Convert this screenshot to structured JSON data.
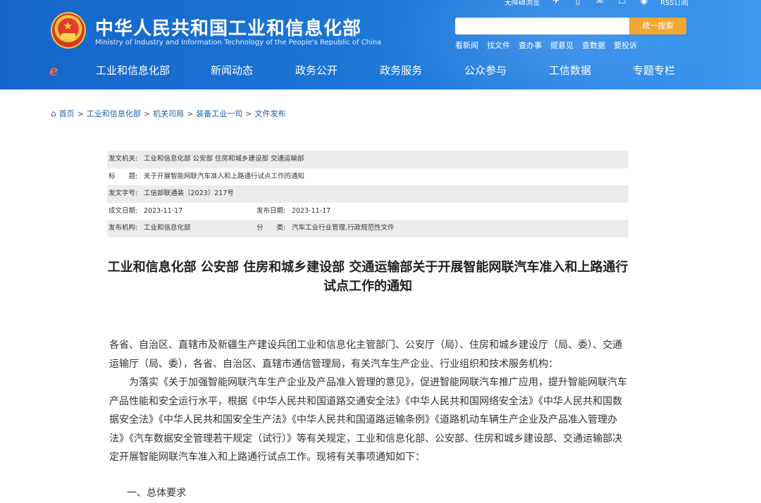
{
  "header": {
    "ministry_name_cn": "中华人民共和国工业和信息化部",
    "ministry_name_en": "Ministry of Industry and Information Technology of the People's Republic of China",
    "accessibility_label": "无障碍浏览",
    "rss_label": "RSS订阅",
    "search": {
      "placeholder": "",
      "button_label": "统一搜索"
    },
    "quick_links": [
      "看新闻",
      "找文件",
      "查办事",
      "提意见",
      "查数据",
      "要投诉"
    ],
    "nav": [
      "工业和信息化部",
      "新闻动态",
      "政务公开",
      "政务服务",
      "公众参与",
      "工信数据",
      "专题专栏"
    ]
  },
  "breadcrumb": [
    "首页",
    "工业和信息化部",
    "机关司局",
    "装备工业一司",
    "文件发布"
  ],
  "meta": {
    "issuer_label": "发文机关:",
    "issuer_value": "工业和信息化部 公安部 住房和城乡建设部 交通运输部",
    "title_label": "标　　题:",
    "title_value": "关于开展智能网联汽车准入和上路通行试点工作的通知",
    "docno_label": "发文字号:",
    "docno_value": "工信部联通装〔2023〕217号",
    "created_label": "成文日期:",
    "created_value": "2023-11-17",
    "published_label": "发布日期:",
    "published_value": "2023-11-17",
    "org_label": "发布机构:",
    "org_value": "工业和信息化部",
    "category_label": "分　　类:",
    "category_value": "汽车工业行业管理,行政规范性文件"
  },
  "document": {
    "title": "工业和信息化部 公安部 住房和城乡建设部 交通运输部关于开展智能网联汽车准入和上路通行试点工作的通知",
    "salutation": "各省、自治区、直辖市及新疆生产建设兵团工业和信息化主管部门、公安厅（局）、住房和城乡建设厅（局、委）、交通运输厅（局、委），各省、自治区、直辖市通信管理局，有关汽车生产企业、行业组织和技术服务机构：",
    "paragraph_1": "为落实《关于加强智能网联汽车生产企业及产品准入管理的意见》，促进智能网联汽车推广应用，提升智能网联汽车产品性能和安全运行水平，根据《中华人民共和国道路交通安全法》《中华人民共和国网络安全法》《中华人民共和国数据安全法》《中华人民共和国安全生产法》《中华人民共和国道路运输条例》《道路机动车辆生产企业及产品准入管理办法》《汽车数据安全管理若干规定（试行）》等有关规定，工业和信息化部、公安部、住房和城乡建设部、交通运输部决定开展智能网联汽车准入和上路通行试点工作。现将有关事项通知如下：",
    "section_1": "一、总体要求"
  },
  "colors": {
    "header_blue": "#1b73d3",
    "search_button": "#f0a733",
    "link_blue": "#1b5fae",
    "meta_shade": "#ececec"
  },
  "icons": [
    "national-emblem-icon",
    "weixin-icon",
    "mobile-icon",
    "mail-icon",
    "user-icon",
    "weibo-icon",
    "home-icon",
    "site-logo-icon"
  ]
}
